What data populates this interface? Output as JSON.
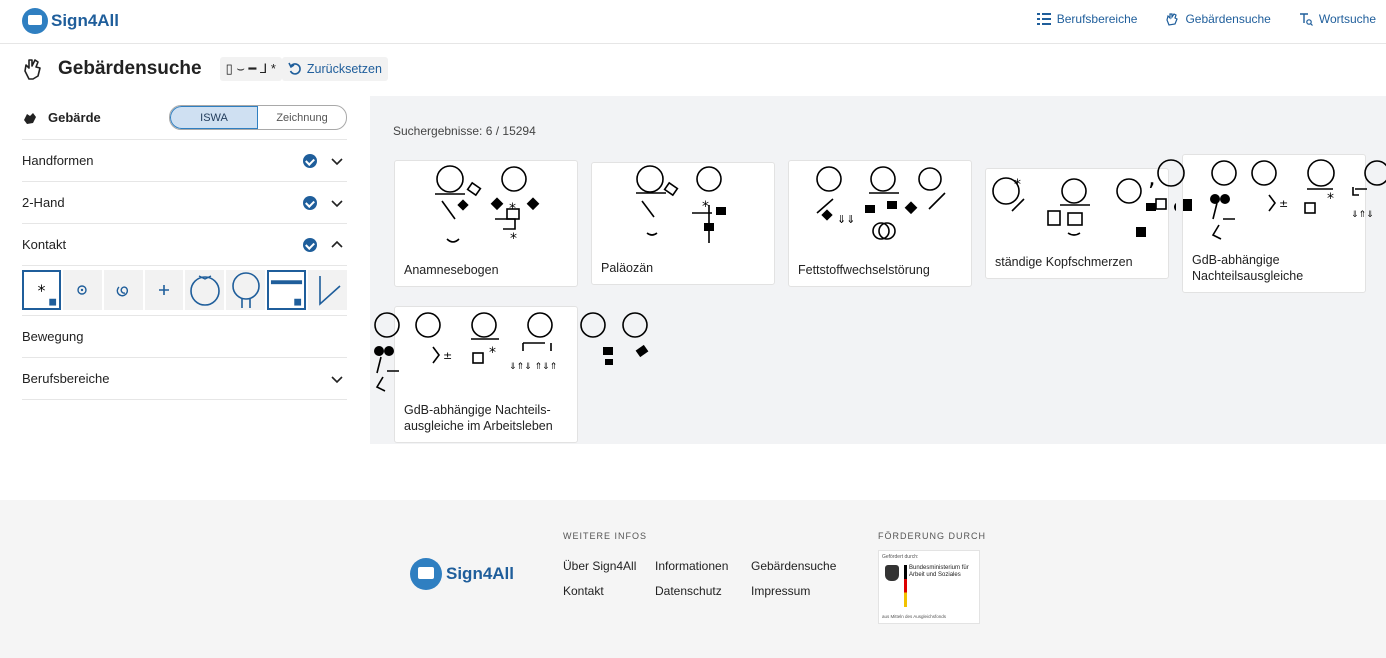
{
  "app": {
    "logo_text": "Sign4All"
  },
  "nav": [
    {
      "label": "Berufsbereiche",
      "icon": "list-icon"
    },
    {
      "label": "Gebärdensuche",
      "icon": "hand-icon"
    },
    {
      "label": "Wortsuche",
      "icon": "text-search-icon"
    }
  ],
  "title": {
    "text": "Gebärdensuche",
    "query_symbols": "▯ ⌣ ━ ⅃ *",
    "reset_label": "Zurücksetzen"
  },
  "filters": {
    "gebaerde_label": "Gebärde",
    "toggle": {
      "on": "ISWA",
      "off": "Zeichnung"
    },
    "rows": [
      {
        "label": "Handformen",
        "checked": true,
        "expanded": false
      },
      {
        "label": "2-Hand",
        "checked": true,
        "expanded": false
      },
      {
        "label": "Kontakt",
        "checked": true,
        "expanded": true
      },
      {
        "label": "Bewegung",
        "checked": false,
        "expanded": null
      },
      {
        "label": "Berufsbereiche",
        "checked": false,
        "expanded": false
      }
    ],
    "contact_symbols": [
      "touch-star",
      "grasp-circle",
      "spiral",
      "plus",
      "head-circle",
      "head-neck",
      "shoulder-bar",
      "slash"
    ],
    "contact_selected": [
      0,
      6
    ]
  },
  "results": {
    "count_text": "Suchergebnisse: 6 / 15294",
    "items": [
      {
        "name": "Anamnesebogen"
      },
      {
        "name": "Paläozän"
      },
      {
        "name": "Fettstoffwechselstörung"
      },
      {
        "name": "ständige Kopfschmerzen"
      },
      {
        "name": "GdB-abhängige Nachteilsausgleiche"
      },
      {
        "name": "GdB-abhängige Nachteils-ausgleiche im Arbeitsleben"
      }
    ]
  },
  "footer": {
    "logo_text": "Sign4All",
    "info_heading": "WEITERE INFOS",
    "links": [
      "Über Sign4All",
      "Informationen",
      "Gebärdensuche",
      "Kontakt",
      "Datenschutz",
      "Impressum"
    ],
    "sponsor_heading": "FÖRDERUNG DURCH",
    "sponsor": {
      "top": "Gefördert durch:",
      "ministry": "Bundesministerium für Arbeit und Soziales",
      "bottom": "aus Mitteln des Ausgleichsfonds"
    }
  }
}
